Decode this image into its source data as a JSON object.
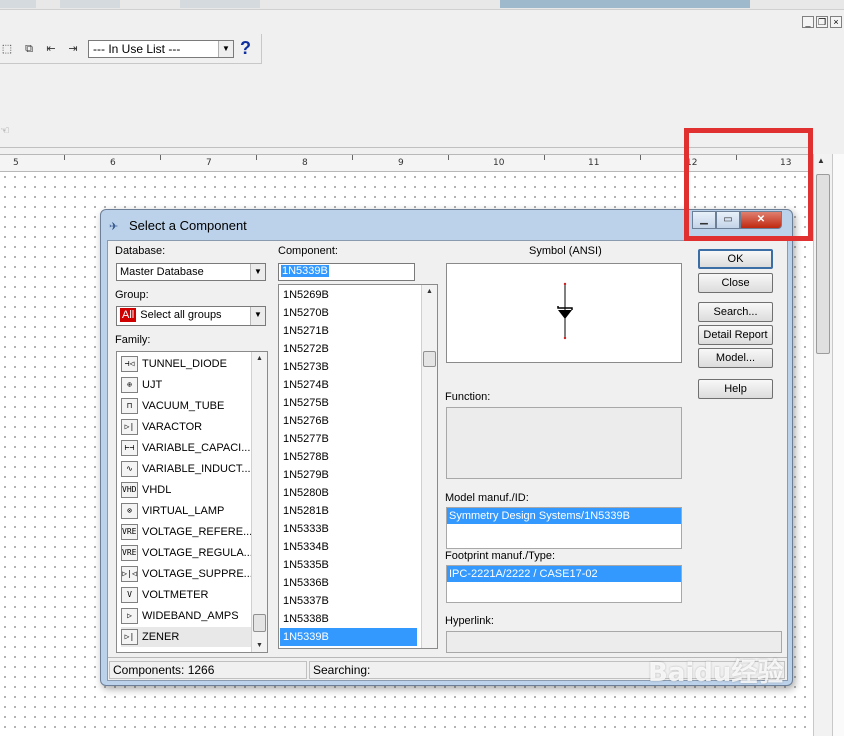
{
  "toolbar": {
    "in_use_list": "--- In Use List ---",
    "help_glyph": "?"
  },
  "mdi_controls": [
    "_",
    "❐",
    "×"
  ],
  "ruler": {
    "labels": [
      "5",
      "6",
      "7",
      "8",
      "9",
      "10",
      "11",
      "12",
      "13"
    ]
  },
  "dialog": {
    "title": "Select a Component",
    "database_label": "Database:",
    "database_value": "Master Database",
    "group_label": "Group:",
    "group_badge": "All",
    "group_value": "Select all groups",
    "family_label": "Family:",
    "families": [
      {
        "name": "TUNNEL_DIODE",
        "icon": "tunnel-diode-icon",
        "glyph": "⊣◁"
      },
      {
        "name": "UJT",
        "icon": "ujt-icon",
        "glyph": "⊕"
      },
      {
        "name": "VACUUM_TUBE",
        "icon": "vacuum-tube-icon",
        "glyph": "⊓"
      },
      {
        "name": "VARACTOR",
        "icon": "varactor-icon",
        "glyph": "▷|"
      },
      {
        "name": "VARIABLE_CAPACI...",
        "icon": "variable-capacitor-icon",
        "glyph": "⊢⊣"
      },
      {
        "name": "VARIABLE_INDUCT...",
        "icon": "variable-inductor-icon",
        "glyph": "∿"
      },
      {
        "name": "VHDL",
        "icon": "vhdl-icon",
        "glyph": "VHDL"
      },
      {
        "name": "VIRTUAL_LAMP",
        "icon": "virtual-lamp-icon",
        "glyph": "⊗"
      },
      {
        "name": "VOLTAGE_REFERE...",
        "icon": "voltage-reference-icon",
        "glyph": "VREF"
      },
      {
        "name": "VOLTAGE_REGULA...",
        "icon": "voltage-regulator-icon",
        "glyph": "VREG"
      },
      {
        "name": "VOLTAGE_SUPPRE...",
        "icon": "voltage-suppressor-icon",
        "glyph": "▷|◁"
      },
      {
        "name": "VOLTMETER",
        "icon": "voltmeter-icon",
        "glyph": "V"
      },
      {
        "name": "WIDEBAND_AMPS",
        "icon": "wideband-amps-icon",
        "glyph": "▷"
      },
      {
        "name": "ZENER",
        "icon": "zener-icon",
        "glyph": "▷|"
      }
    ],
    "component_label": "Component:",
    "component_value": "1N5339B",
    "components": [
      "1N5269B",
      "1N5270B",
      "1N5271B",
      "1N5272B",
      "1N5273B",
      "1N5274B",
      "1N5275B",
      "1N5276B",
      "1N5277B",
      "1N5278B",
      "1N5279B",
      "1N5280B",
      "1N5281B",
      "1N5333B",
      "1N5334B",
      "1N5335B",
      "1N5336B",
      "1N5337B",
      "1N5338B",
      "1N5339B"
    ],
    "selected_component": "1N5339B",
    "symbol_label": "Symbol (ANSI)",
    "function_label": "Function:",
    "model_label": "Model manuf./ID:",
    "model_value": "Symmetry Design Systems/1N5339B",
    "footprint_label": "Footprint manuf./Type:",
    "footprint_value": "IPC-2221A/2222 / CASE17-02",
    "hyperlink_label": "Hyperlink:",
    "buttons": {
      "ok": "OK",
      "close": "Close",
      "search": "Search...",
      "detail_report": "Detail Report",
      "model": "Model...",
      "help": "Help"
    },
    "status_components": "Components: 1266",
    "status_searching": "Searching:"
  },
  "colors": {
    "highlight_box": "#e03030",
    "selection": "#3399ff",
    "dialog_frame": "#bcd2ea"
  },
  "watermark": "Baidu经验"
}
